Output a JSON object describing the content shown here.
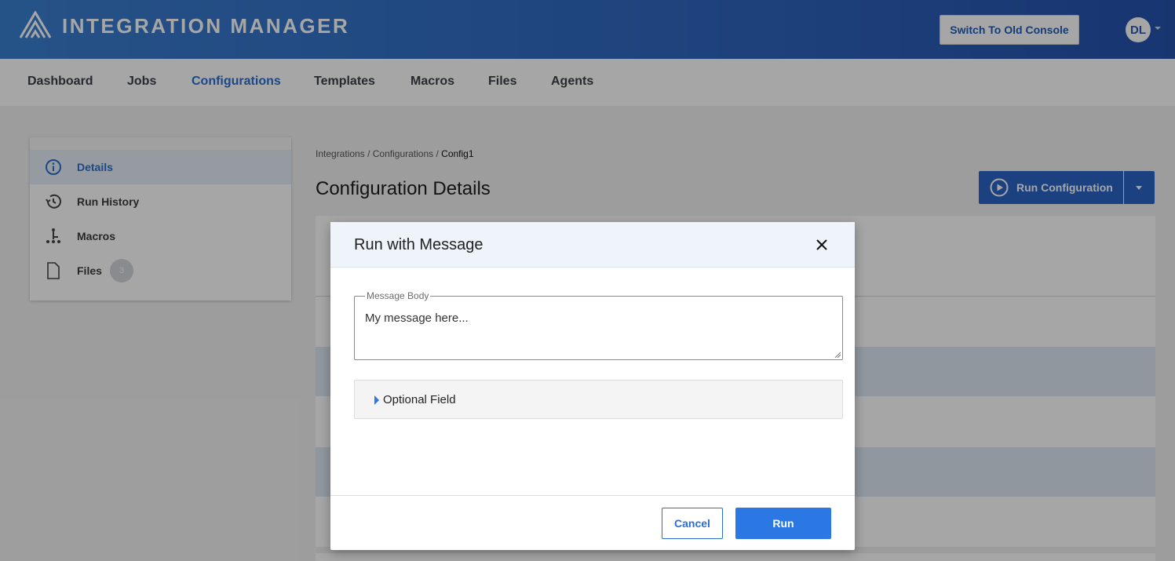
{
  "header": {
    "app_title": "INTEGRATION MANAGER",
    "logo_icon": "triangle-stripes-logo",
    "switch_label": "Switch To Old Console",
    "avatar_initials": "DL"
  },
  "nav": {
    "items": [
      {
        "label": "Dashboard",
        "active": false
      },
      {
        "label": "Jobs",
        "active": false
      },
      {
        "label": "Configurations",
        "active": true
      },
      {
        "label": "Templates",
        "active": false
      },
      {
        "label": "Macros",
        "active": false
      },
      {
        "label": "Files",
        "active": false
      },
      {
        "label": "Agents",
        "active": false
      }
    ]
  },
  "sidebar": {
    "items": [
      {
        "label": "Details",
        "icon": "info-icon",
        "active": true
      },
      {
        "label": "Run History",
        "icon": "history-icon",
        "active": false
      },
      {
        "label": "Macros",
        "icon": "macro-tree-icon",
        "active": false
      },
      {
        "label": "Files",
        "icon": "file-icon",
        "active": false,
        "badge": "3"
      }
    ]
  },
  "breadcrumb": {
    "items": [
      "Integrations",
      "Configurations"
    ],
    "separator": "/",
    "current": "Config1"
  },
  "page": {
    "title": "Configuration Details",
    "run_button_label": "Run Configuration"
  },
  "modal": {
    "title": "Run with Message",
    "field_label": "Message Body",
    "field_value": "My message here...",
    "optional_label": "Optional Field",
    "cancel_label": "Cancel",
    "run_label": "Run"
  },
  "colors": {
    "header_start": "#3a7fd0",
    "header_end": "#2552ad",
    "accent": "#2b6fd0",
    "primary_button": "#2b78e4"
  }
}
